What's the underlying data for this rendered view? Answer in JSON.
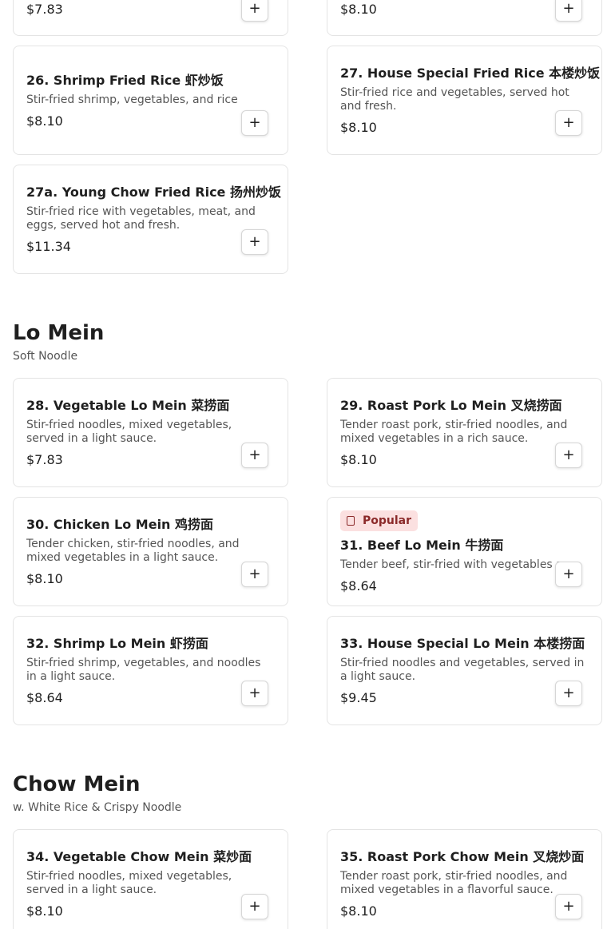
{
  "add_button_label": "+",
  "accent_colors": {
    "popular_badge_bg": "#fbe0e0",
    "popular_badge_text": "#8b2a2a"
  },
  "top_partial_cards": [
    {
      "price": "$7.83"
    },
    {
      "price": "$8.10"
    }
  ],
  "fried_rice_items": [
    {
      "name": "26. Shrimp Fried Rice 虾炒饭",
      "desc": "Stir-fried shrimp, vegetables, and rice",
      "price": "$8.10"
    },
    {
      "name": "27. House Special Fried Rice 本楼炒饭",
      "desc": "Stir-fried rice and vegetables, served hot and fresh.",
      "price": "$8.10"
    },
    {
      "name": "27a. Young Chow Fried Rice 扬州炒饭",
      "desc": "Stir-fried rice with vegetables, meat, and eggs, served hot and fresh.",
      "price": "$11.34"
    }
  ],
  "lo_mein": {
    "title": "Lo Mein",
    "subtitle": "Soft Noodle",
    "items": [
      {
        "name": "28. Vegetable Lo Mein 菜捞面",
        "desc": "Stir-fried noodles, mixed vegetables, served in a light sauce.",
        "price": "$7.83"
      },
      {
        "name": "29. Roast Pork Lo Mein 叉烧捞面",
        "desc": "Tender roast pork, stir-fried noodles, and mixed vegetables in a rich sauce.",
        "price": "$8.10"
      },
      {
        "name": "30. Chicken Lo Mein 鸡捞面",
        "desc": "Tender chicken, stir-fried noodles, and mixed vegetables in a light sauce.",
        "price": "$8.10"
      },
      {
        "name": "31. Beef Lo Mein 牛捞面",
        "desc": "Tender beef, stir-fried with vegetables and noodles.",
        "price": "$8.64",
        "badge": "Popular"
      },
      {
        "name": "32. Shrimp Lo Mein 虾捞面",
        "desc": "Stir-fried shrimp, vegetables, and noodles in a light sauce.",
        "price": "$8.64"
      },
      {
        "name": "33. House Special Lo Mein 本楼捞面",
        "desc": "Stir-fried noodles and vegetables, served in a light sauce.",
        "price": "$9.45"
      }
    ]
  },
  "chow_mein": {
    "title": "Chow Mein",
    "subtitle": "w. White Rice & Crispy Noodle",
    "items": [
      {
        "name": "34. Vegetable Chow Mein 菜炒面",
        "desc": "Stir-fried noodles, mixed vegetables, served in a light sauce.",
        "price": "$8.10"
      },
      {
        "name": "35. Roast Pork Chow Mein 叉烧炒面",
        "desc": "Tender roast pork, stir-fried noodles, and mixed vegetables in a flavorful sauce.",
        "price": "$8.10"
      }
    ]
  }
}
